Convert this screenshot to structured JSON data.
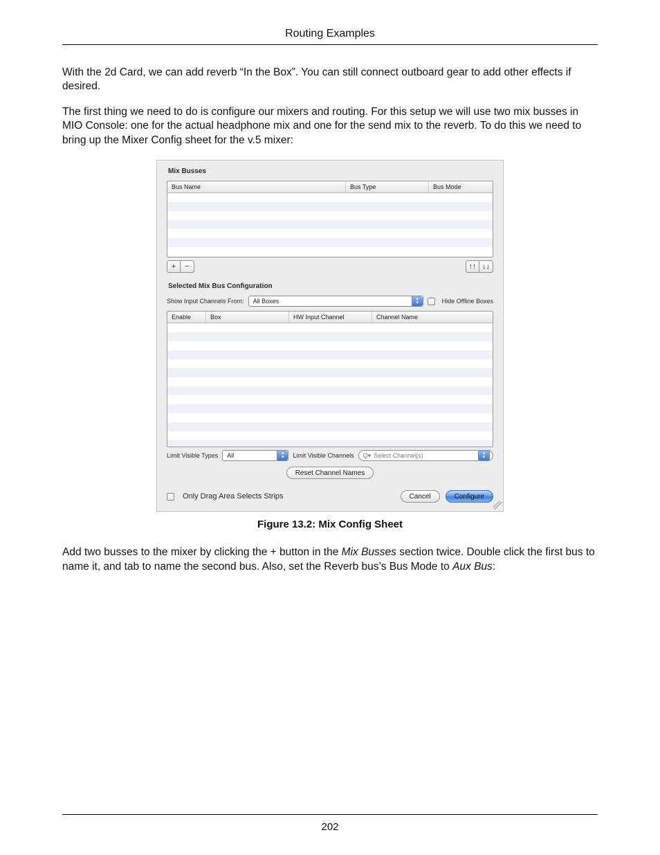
{
  "header": {
    "running": "Routing Examples"
  },
  "footer": {
    "page": "202"
  },
  "paragraphs": {
    "p1": "With the 2d Card, we can add reverb “In the Box”. You can still connect outboard gear to add other effects if desired.",
    "p2": "The first thing we need to do is configure our mixers and routing. For this setup we will use two mix busses in MIO Console: one for the actual headphone mix and one for the send mix to the reverb. To do this we need to bring up the Mixer Config sheet for the v.5 mixer:",
    "p3a": "Add two busses to the mixer by clicking the + button in the ",
    "p3b": "Mix Busses",
    "p3c": " section twice. Double click the first bus to name it, and tab to name the second bus. Also, set the Reverb bus’s Bus Mode to ",
    "p3d": "Aux Bus",
    "p3e": ":"
  },
  "figure": {
    "caption": "Figure 13.2: Mix Config Sheet"
  },
  "dialog": {
    "section1_title": "Mix Busses",
    "top_table": {
      "cols": {
        "c1": "Bus Name",
        "c2": "Bus Type",
        "c3": "Bus Mode"
      }
    },
    "buttons": {
      "add": "+",
      "remove": "−",
      "up": "↑↑",
      "down": "↓↓"
    },
    "section2_title": "Selected Mix Bus Configuration",
    "show_from_label": "Show Input Channels From:",
    "show_from_value": "All Boxes",
    "hide_offline_label": "Hide Offline Boxes",
    "bottom_table": {
      "cols": {
        "c1": "Enable",
        "c2": "Box",
        "c3": "HW Input Channel",
        "c4": "Channel Name"
      }
    },
    "limit_types_label": "Limit Visible Types",
    "limit_types_value": "All",
    "limit_channels_label": "Limit Visible Channels",
    "limit_channels_placeholder": "Select Channel(s)",
    "reset_button": "Reset Channel Names",
    "drag_label": "Only Drag Area Selects Strips",
    "cancel": "Cancel",
    "configure": "Configure"
  }
}
